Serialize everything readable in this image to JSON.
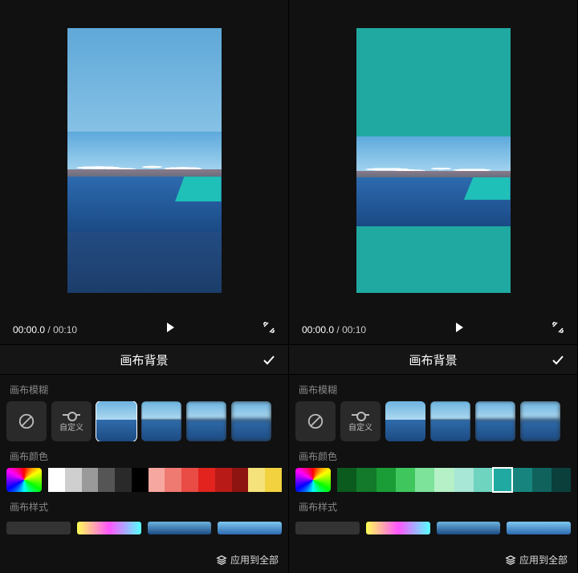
{
  "left": {
    "time_current": "00:00.0",
    "time_total": "00:10",
    "toolbar_title": "画布背景",
    "sections": {
      "blur": "画布模糊",
      "color": "画布颜色",
      "style": "画布样式"
    },
    "custom_label": "自定义",
    "apply_all": "应用到全部",
    "blur_selected_index": 2,
    "color_swatches": [
      "#ffffff",
      "#cfcfcf",
      "#9a9a9a",
      "#555555",
      "#2a2a2a",
      "#000000",
      "#f6a8a0",
      "#ef7a72",
      "#e84c45",
      "#e2231e",
      "#b81b17",
      "#8d1411",
      "#f6e27a",
      "#f2d23e"
    ],
    "color_selected_index": -1,
    "canvas_bg_mode": "blur"
  },
  "right": {
    "time_current": "00:00.0",
    "time_total": "00:10",
    "toolbar_title": "画布背景",
    "sections": {
      "blur": "画布模糊",
      "color": "画布颜色",
      "style": "画布样式"
    },
    "custom_label": "自定义",
    "apply_all": "应用到全部",
    "blur_selected_index": -1,
    "color_swatches": [
      "#0b5a1e",
      "#127a2a",
      "#1a9c36",
      "#3fc75e",
      "#7de29a",
      "#b5f0c6",
      "#a8e6d6",
      "#6fd4bf",
      "#1fa9a0",
      "#17857e",
      "#10625d",
      "#0a3f3c"
    ],
    "color_selected_index": 8,
    "canvas_bg_mode": "solid",
    "canvas_bg_color": "#1fa9a0"
  }
}
